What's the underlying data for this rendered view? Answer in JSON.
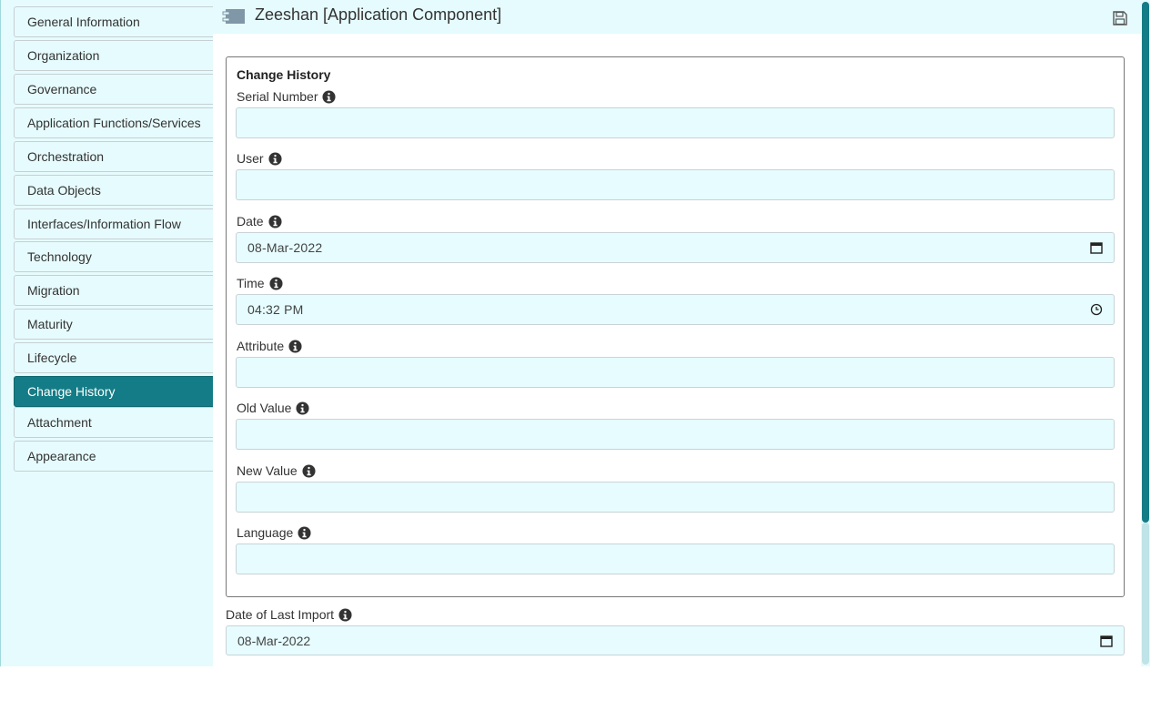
{
  "sidebar": {
    "items": [
      {
        "label": "General Information"
      },
      {
        "label": "Organization"
      },
      {
        "label": "Governance"
      },
      {
        "label": "Application Functions/Services"
      },
      {
        "label": "Orchestration"
      },
      {
        "label": "Data Objects"
      },
      {
        "label": "Interfaces/Information Flow"
      },
      {
        "label": "Technology"
      },
      {
        "label": "Migration"
      },
      {
        "label": "Maturity"
      },
      {
        "label": "Lifecycle"
      },
      {
        "label": "Change History"
      },
      {
        "label": "Attachment"
      },
      {
        "label": "Appearance"
      }
    ],
    "active_item": "Change History"
  },
  "header": {
    "title": "Zeeshan [Application Component]",
    "icon": "application-component-icon",
    "save_icon": "save-icon"
  },
  "panel": {
    "title": "Change History",
    "fields": [
      {
        "label": "Serial Number",
        "value": "",
        "type": "text"
      },
      {
        "label": "User",
        "value": "",
        "type": "text"
      },
      {
        "label": "Date",
        "value": "08-Mar-2022",
        "type": "date"
      },
      {
        "label": "Time",
        "value": "04:32 PM",
        "type": "time"
      },
      {
        "label": "Attribute",
        "value": "",
        "type": "text"
      },
      {
        "label": "Old Value",
        "value": "",
        "type": "text"
      },
      {
        "label": "New Value",
        "value": "",
        "type": "text"
      },
      {
        "label": "Language",
        "value": "",
        "type": "text"
      }
    ]
  },
  "last_import": {
    "label": "Date of Last Import",
    "value": "08-Mar-2022",
    "type": "date"
  },
  "colors": {
    "accent": "#147c86",
    "field_bg": "#e6fcfe",
    "sidebar_bg": "#e6fbfd"
  }
}
